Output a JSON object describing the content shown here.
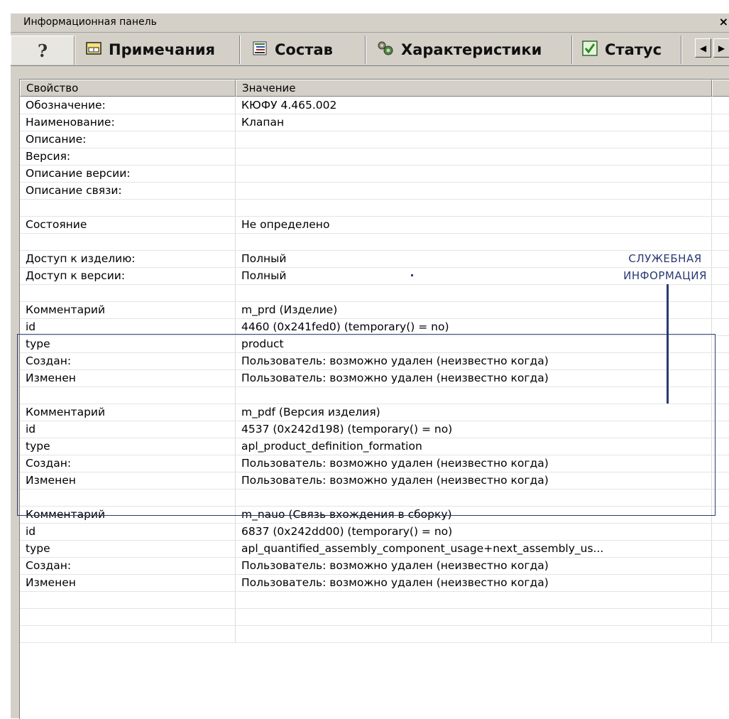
{
  "panel": {
    "title": "Информационная панель",
    "close_glyph": "×"
  },
  "tabs": [
    {
      "label": "?",
      "icon": "help-icon"
    },
    {
      "label": "Примечания",
      "icon": "notes-icon"
    },
    {
      "label": "Состав",
      "icon": "composition-icon"
    },
    {
      "label": "Характеристики",
      "icon": "characteristics-icon"
    },
    {
      "label": "Статус",
      "icon": "status-check-icon"
    }
  ],
  "tab_scroll": {
    "left": "◀",
    "right": "▶"
  },
  "table": {
    "headers": [
      "Свойство",
      "Значение"
    ],
    "rows": [
      [
        "Обозначение:",
        "КЮФУ 4.465.002"
      ],
      [
        "Наименование:",
        "Клапан"
      ],
      [
        "Описание:",
        ""
      ],
      [
        "Версия:",
        ""
      ],
      [
        "Описание версии:",
        ""
      ],
      [
        "Описание связи:",
        ""
      ],
      [
        "",
        ""
      ],
      [
        "Состояние",
        "Не определено"
      ],
      [
        "",
        ""
      ],
      [
        "Доступ к изделию:",
        "Полный"
      ],
      [
        "Доступ к версии:",
        "Полный"
      ],
      [
        "",
        ""
      ],
      [
        "Комментарий",
        "m_prd (Изделие)"
      ],
      [
        "id",
        "4460 (0x241fed0) (temporary() = no)"
      ],
      [
        "type",
        "product"
      ],
      [
        "Создан:",
        "Пользователь: возможно удален (неизвестно когда)"
      ],
      [
        "Изменен",
        "Пользователь: возможно удален (неизвестно когда)"
      ],
      [
        "",
        ""
      ],
      [
        "Комментарий",
        "m_pdf (Версия изделия)"
      ],
      [
        "id",
        "4537 (0x242d198) (temporary() = no)"
      ],
      [
        "type",
        "apl_product_definition_formation"
      ],
      [
        "Создан:",
        "Пользователь: возможно удален (неизвестно когда)"
      ],
      [
        "Изменен",
        "Пользователь: возможно удален (неизвестно когда)"
      ],
      [
        "",
        ""
      ],
      [
        "Комментарий",
        "m_nauo  (Связь вхождения в сборку)"
      ],
      [
        "id",
        "6837 (0x242dd00) (temporary() = no)"
      ],
      [
        "type",
        "apl_quantified_assembly_component_usage+next_assembly_us..."
      ],
      [
        "Создан:",
        "Пользователь: возможно удален (неизвестно когда)"
      ],
      [
        "Изменен",
        "Пользователь: возможно удален (неизвестно когда)"
      ],
      [
        "",
        ""
      ],
      [
        "",
        ""
      ],
      [
        "",
        ""
      ]
    ]
  },
  "annotation": {
    "line1": "СЛУЖЕБНАЯ",
    "line2": "ИНФОРМАЦИЯ",
    "color": "#2a3a72"
  }
}
